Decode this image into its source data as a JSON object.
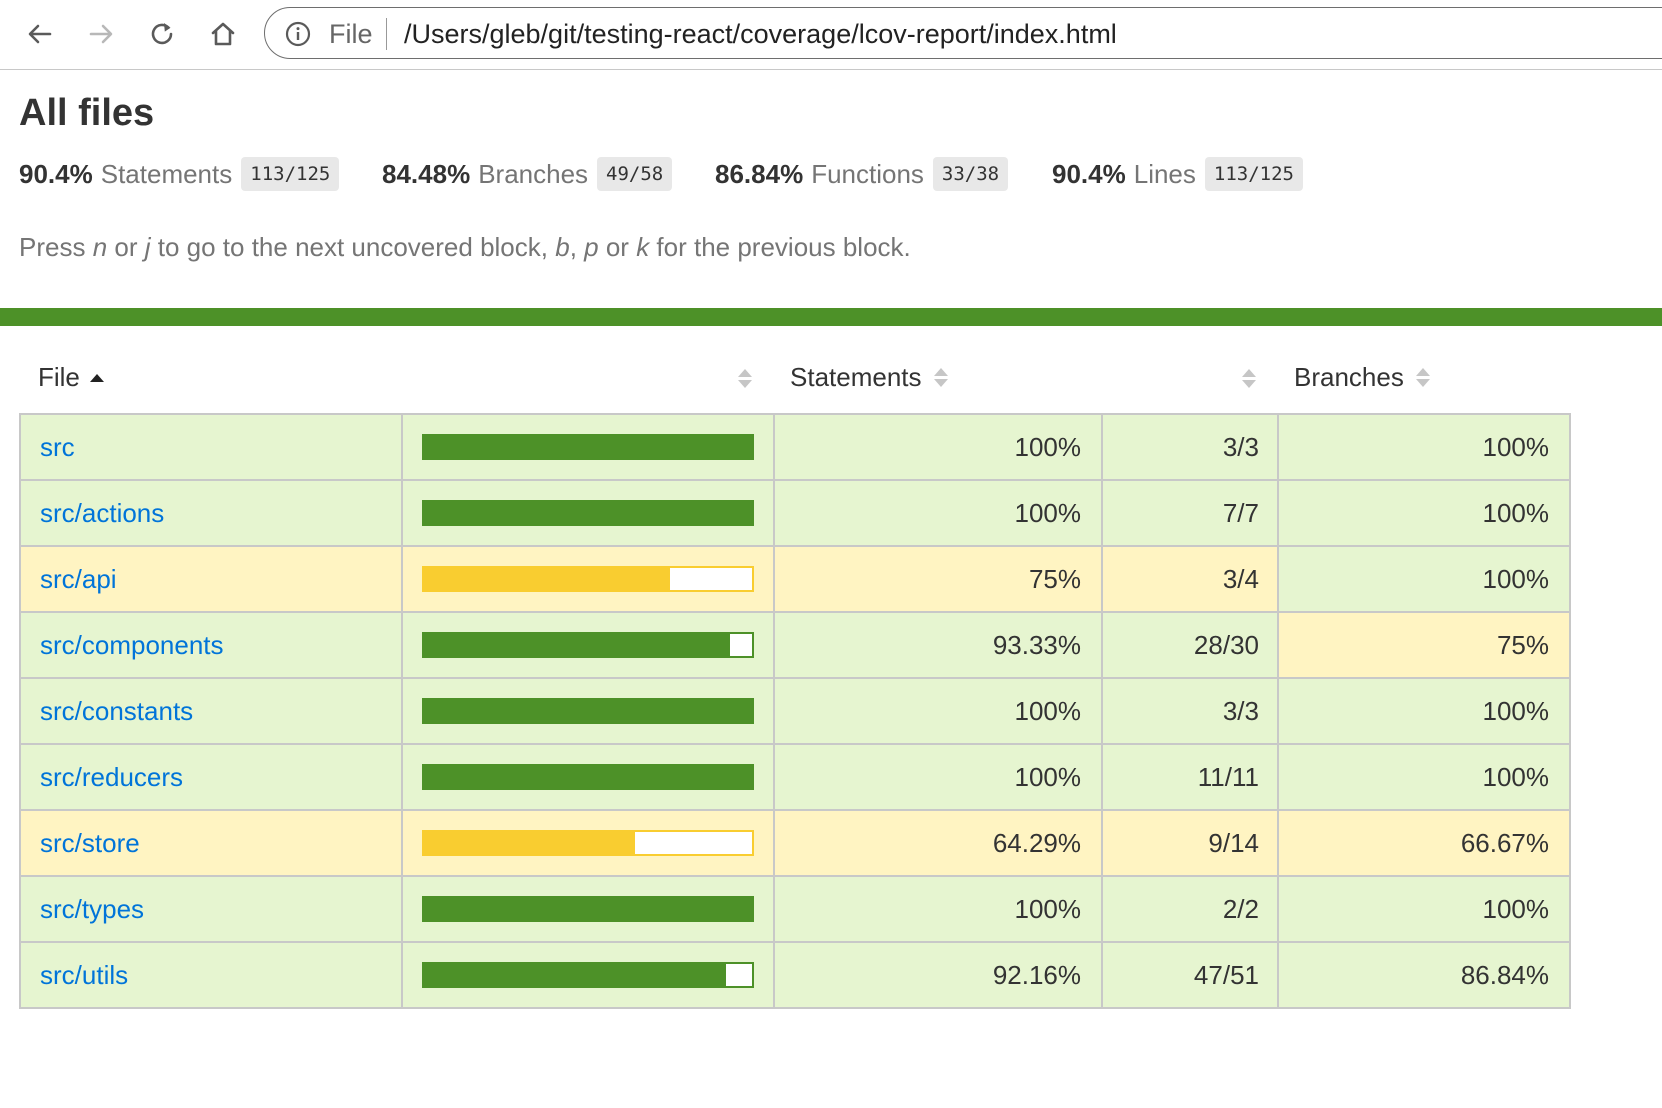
{
  "browser": {
    "scheme_label": "File",
    "url": "/Users/gleb/git/testing-react/coverage/lcov-report/index.html"
  },
  "page": {
    "title": "All files"
  },
  "summary": {
    "statements": {
      "pct": "90.4%",
      "label": "Statements",
      "fraction": "113/125"
    },
    "branches": {
      "pct": "84.48%",
      "label": "Branches",
      "fraction": "49/58"
    },
    "functions": {
      "pct": "86.84%",
      "label": "Functions",
      "fraction": "33/38"
    },
    "lines": {
      "pct": "90.4%",
      "label": "Lines",
      "fraction": "113/125"
    }
  },
  "hint": {
    "press": "Press ",
    "n": "n",
    "or1": " or ",
    "j": "j",
    "to_next": " to go to the next uncovered block, ",
    "b": "b",
    "comma": ", ",
    "p": "p",
    "or2": " or ",
    "k": "k",
    "for_prev": " for the previous block."
  },
  "table": {
    "headers": {
      "file": "File",
      "statements": "Statements",
      "branches": "Branches"
    },
    "rows": [
      {
        "file": "src",
        "coverage": 1.0,
        "statements_pct": "100%",
        "statements_fraction": "3/3",
        "branches_pct": "100%",
        "status": "high",
        "branch_status": "high"
      },
      {
        "file": "src/actions",
        "coverage": 1.0,
        "statements_pct": "100%",
        "statements_fraction": "7/7",
        "branches_pct": "100%",
        "status": "high",
        "branch_status": "high"
      },
      {
        "file": "src/api",
        "coverage": 0.75,
        "statements_pct": "75%",
        "statements_fraction": "3/4",
        "branches_pct": "100%",
        "status": "medium",
        "branch_status": "high"
      },
      {
        "file": "src/components",
        "coverage": 0.9333,
        "statements_pct": "93.33%",
        "statements_fraction": "28/30",
        "branches_pct": "75%",
        "status": "high",
        "branch_status": "medium"
      },
      {
        "file": "src/constants",
        "coverage": 1.0,
        "statements_pct": "100%",
        "statements_fraction": "3/3",
        "branches_pct": "100%",
        "status": "high",
        "branch_status": "high"
      },
      {
        "file": "src/reducers",
        "coverage": 1.0,
        "statements_pct": "100%",
        "statements_fraction": "11/11",
        "branches_pct": "100%",
        "status": "high",
        "branch_status": "high"
      },
      {
        "file": "src/store",
        "coverage": 0.6429,
        "statements_pct": "64.29%",
        "statements_fraction": "9/14",
        "branches_pct": "66.67%",
        "status": "medium",
        "branch_status": "medium"
      },
      {
        "file": "src/types",
        "coverage": 1.0,
        "statements_pct": "100%",
        "statements_fraction": "2/2",
        "branches_pct": "100%",
        "status": "high",
        "branch_status": "high"
      },
      {
        "file": "src/utils",
        "coverage": 0.9216,
        "statements_pct": "92.16%",
        "statements_fraction": "47/51",
        "branches_pct": "86.84%",
        "status": "high",
        "branch_status": "high"
      }
    ]
  },
  "colors": {
    "high_bg": "#e6f5d0",
    "high_bar": "#4d9128",
    "medium_bg": "#fff4c2",
    "medium_bar": "#f9cd30",
    "status_strip": "#4d9128",
    "link": "#0074d9"
  }
}
